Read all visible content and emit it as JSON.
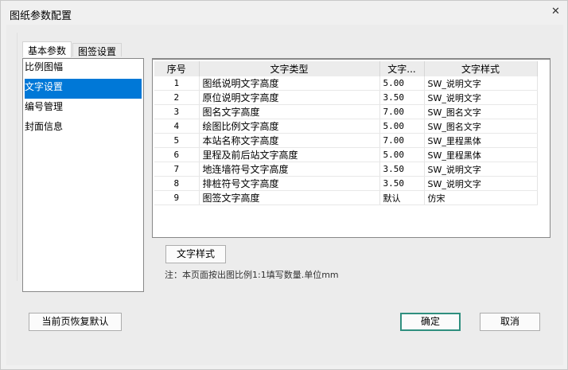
{
  "window": {
    "title": "图纸参数配置",
    "close_icon": "close-icon"
  },
  "tabs": [
    {
      "label": "基本参数",
      "active": true
    },
    {
      "label": "图签设置",
      "active": false
    }
  ],
  "sidebar": {
    "items": [
      {
        "label": "比例图幅"
      },
      {
        "label": "文字设置",
        "selected": true
      },
      {
        "label": "编号管理"
      },
      {
        "label": "封面信息"
      }
    ]
  },
  "table": {
    "headers": [
      "序号",
      "文字类型",
      "文字...",
      "文字样式"
    ],
    "rows": [
      [
        "1",
        "图纸说明文字高度",
        "5.00",
        "SW_说明文字"
      ],
      [
        "2",
        "原位说明文字高度",
        "3.50",
        "SW_说明文字"
      ],
      [
        "3",
        "图名文字高度",
        "7.00",
        "SW_图名文字"
      ],
      [
        "4",
        "绘图比例文字高度",
        "5.00",
        "SW_图名文字"
      ],
      [
        "5",
        "本站名称文字高度",
        "7.00",
        "SW_里程黑体"
      ],
      [
        "6",
        "里程及前后站文字高度",
        "5.00",
        "SW_里程黑体"
      ],
      [
        "7",
        "地连墙符号文字高度",
        "3.50",
        "SW_说明文字"
      ],
      [
        "8",
        "排桩符号文字高度",
        "3.50",
        "SW_说明文字"
      ],
      [
        "9",
        "图签文字高度",
        "默认",
        "仿宋"
      ]
    ]
  },
  "text_style_button": "文字样式",
  "note": "注：本页面按出图比例1:1填写数量.单位mm",
  "footer": {
    "restore": "当前页恢复默认",
    "ok": "确定",
    "cancel": "取消"
  },
  "colors": {
    "selection": "#0078d7",
    "primary_border": "#2f8f7f"
  }
}
